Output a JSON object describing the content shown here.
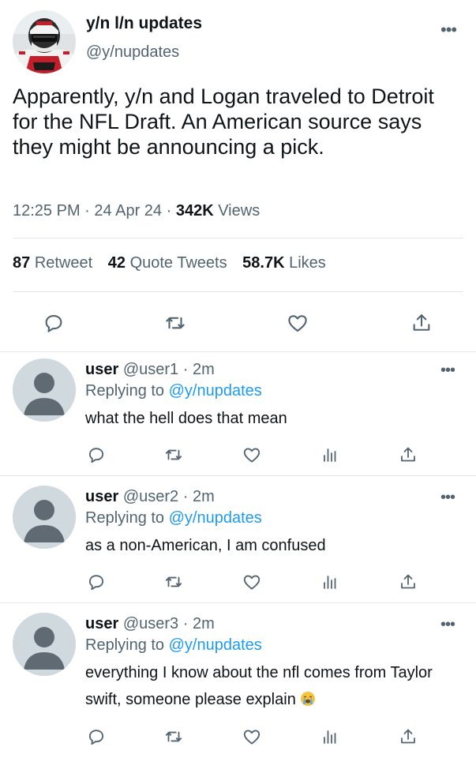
{
  "tweet": {
    "author_name": "y/n l/n updates",
    "author_handle": "@y/nupdates",
    "more": "•••",
    "text": "Apparently, y/n and Logan traveled to Detroit for the NFL Draft. An American source says they might be announcing a pick.",
    "time": "12:25 PM",
    "date": "24 Apr 24",
    "views_count": "342K",
    "views_label": "Views",
    "separator": "·",
    "retweets_count": "87",
    "retweets_label": "Retweet",
    "quotes_count": "42",
    "quotes_label": "Quote Tweets",
    "likes_count": "58.7K",
    "likes_label": "Likes"
  },
  "icons": {
    "reply": "reply-icon",
    "retweet": "retweet-icon",
    "like": "heart-icon",
    "share": "share-icon",
    "views": "views-icon"
  },
  "colors": {
    "accent": "#1d9bf0",
    "text": "#0f1419",
    "secondary": "#536471"
  },
  "replies": [
    {
      "name": "user",
      "handle": "@user1",
      "sep": "·",
      "time": "2m",
      "replying_prefix": "Replying to",
      "replying_to": "@y/nupdates",
      "text": "what the hell does that mean",
      "more": "•••"
    },
    {
      "name": "user",
      "handle": "@user2",
      "sep": "·",
      "time": "2m",
      "replying_prefix": "Replying to",
      "replying_to": "@y/nupdates",
      "text": "as a non-American, I am confused",
      "more": "•••"
    },
    {
      "name": "user",
      "handle": "@user3",
      "sep": "·",
      "time": "2m",
      "replying_prefix": "Replying to",
      "replying_to": "@y/nupdates",
      "text": "everything I know about the nfl comes from Taylor swift, someone please explain",
      "more": "•••"
    }
  ]
}
